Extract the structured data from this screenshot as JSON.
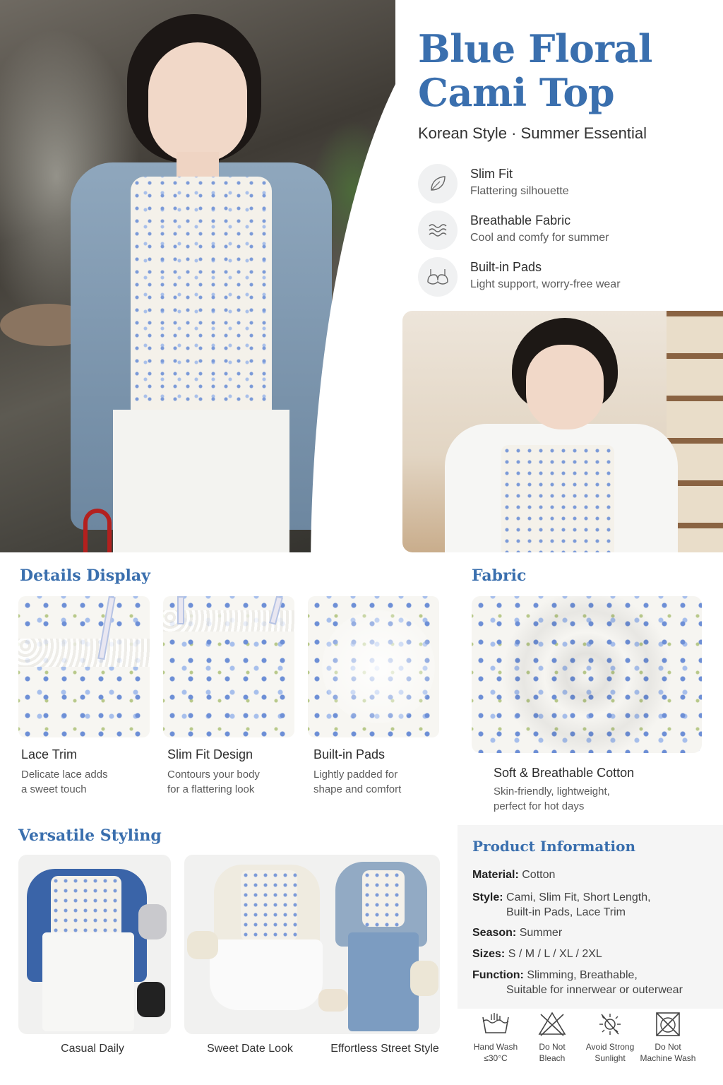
{
  "header": {
    "title_line1": "Blue Floral",
    "title_line2": "Cami Top",
    "subtitle": "Korean Style · Summer Essential"
  },
  "features": [
    {
      "icon": "leaf-icon",
      "title": "Slim Fit",
      "desc": "Flattering silhouette"
    },
    {
      "icon": "wind-waves-icon",
      "title": "Breathable Fabric",
      "desc": "Cool and comfy for summer"
    },
    {
      "icon": "bra-icon",
      "title": "Built-in Pads",
      "desc": "Light support, worry-free wear"
    }
  ],
  "details": {
    "heading": "Details Display",
    "items": [
      {
        "title": "Lace Trim",
        "desc1": "Delicate lace adds",
        "desc2": "a sweet touch"
      },
      {
        "title": "Slim Fit Design",
        "desc1": "Contours your body",
        "desc2": "for a flattering look"
      },
      {
        "title": "Built-in Pads",
        "desc1": "Lightly padded for",
        "desc2": "shape and comfort"
      }
    ]
  },
  "fabric": {
    "heading": "Fabric",
    "title": "Soft & Breathable Cotton",
    "desc1": "Skin-friendly, lightweight,",
    "desc2": "perfect for hot days"
  },
  "styling": {
    "heading": "Versatile Styling",
    "looks": [
      "Casual Daily",
      "Sweet Date Look",
      "Effortless Street Style"
    ]
  },
  "product_info": {
    "heading": "Product Information",
    "rows": [
      {
        "key": "Material:",
        "value": "Cotton",
        "value2": ""
      },
      {
        "key": "Style:",
        "value": "Cami, Slim Fit, Short Length,",
        "value2": "Built-in Pads, Lace Trim"
      },
      {
        "key": "Season:",
        "value": "Summer",
        "value2": ""
      },
      {
        "key": "Sizes:",
        "value": "S / M / L / XL / 2XL",
        "value2": ""
      },
      {
        "key": "Function:",
        "value": "Slimming, Breathable,",
        "value2": "Suitable for innerwear or outerwear"
      }
    ]
  },
  "care": [
    {
      "icon": "hand-wash-icon",
      "line1": "Hand Wash",
      "line2": "≤30°C"
    },
    {
      "icon": "no-bleach-icon",
      "line1": "Do Not",
      "line2": "Bleach"
    },
    {
      "icon": "no-sunlight-icon",
      "line1": "Avoid Strong",
      "line2": "Sunlight"
    },
    {
      "icon": "no-machine-wash-icon",
      "line1": "Do Not",
      "line2": "Machine Wash"
    }
  ],
  "colors": {
    "accent": "#3a6fae",
    "panel": "#f5f5f5"
  }
}
